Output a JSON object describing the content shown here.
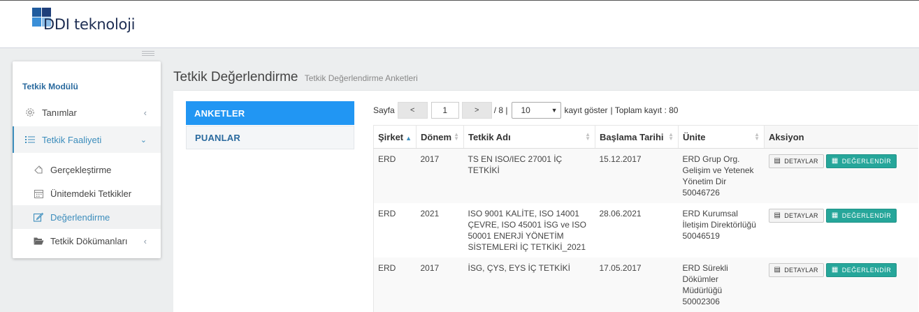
{
  "brand": {
    "name": "DDI teknoloji"
  },
  "sidebar": {
    "title": "Tetkik Modülü",
    "items": [
      {
        "label": "Tanımlar",
        "icon": "gear-icon"
      },
      {
        "label": "Tetkik Faaliyeti",
        "icon": "list-icon"
      },
      {
        "label": "Gerçekleştirme",
        "icon": "tag-icon"
      },
      {
        "label": "Ünitemdeki Tetkikler",
        "icon": "calendar-icon"
      },
      {
        "label": "Değerlendirme",
        "icon": "edit-icon"
      },
      {
        "label": "Tetkik Dökümanları",
        "icon": "folder-icon"
      }
    ]
  },
  "page": {
    "title": "Tetkik Değerlendirme",
    "subtitle": "Tetkik Değerlendirme Anketleri"
  },
  "tabs": {
    "anketler": "ANKETLER",
    "puanlar": "PUANLAR"
  },
  "pager": {
    "label": "Sayfa",
    "prev": "<",
    "current": "1",
    "next": ">",
    "total": "/ 8 |",
    "page_size": "10",
    "show_label": "kayıt göster",
    "total_label": "| Toplam kayıt : 80"
  },
  "table": {
    "headers": [
      "Şirket",
      "Dönem",
      "Tetkik Adı",
      "Başlama Tarihi",
      "Ünite",
      "Aksiyon"
    ],
    "rows": [
      {
        "sirket": "ERD",
        "donem": "2017",
        "ad": "TS EN ISO/IEC 27001 İÇ TETKİKİ",
        "tarih": "15.12.2017",
        "unite": "ERD Grup Org. Gelişim ve Yetenek Yönetim Dir 50046726"
      },
      {
        "sirket": "ERD",
        "donem": "2021",
        "ad": "ISO 9001 KALİTE, ISO 14001 ÇEVRE, ISO 45001 İSG ve ISO 50001 ENERJİ YÖNETİM SİSTEMLERİ İÇ TETKİKİ_2021",
        "tarih": "28.06.2021",
        "unite": "ERD Kurumsal İletişim Direktörlüğü 50046519"
      },
      {
        "sirket": "ERD",
        "donem": "2017",
        "ad": "İSG, ÇYS, EYS İÇ TETKİKİ",
        "tarih": "17.05.2017",
        "unite": "ERD Sürekli Dökümler Müdürlüğü 50002306"
      }
    ],
    "btn_detay": "DETAYLAR",
    "btn_degerlendir": "DEĞERLENDİR"
  }
}
